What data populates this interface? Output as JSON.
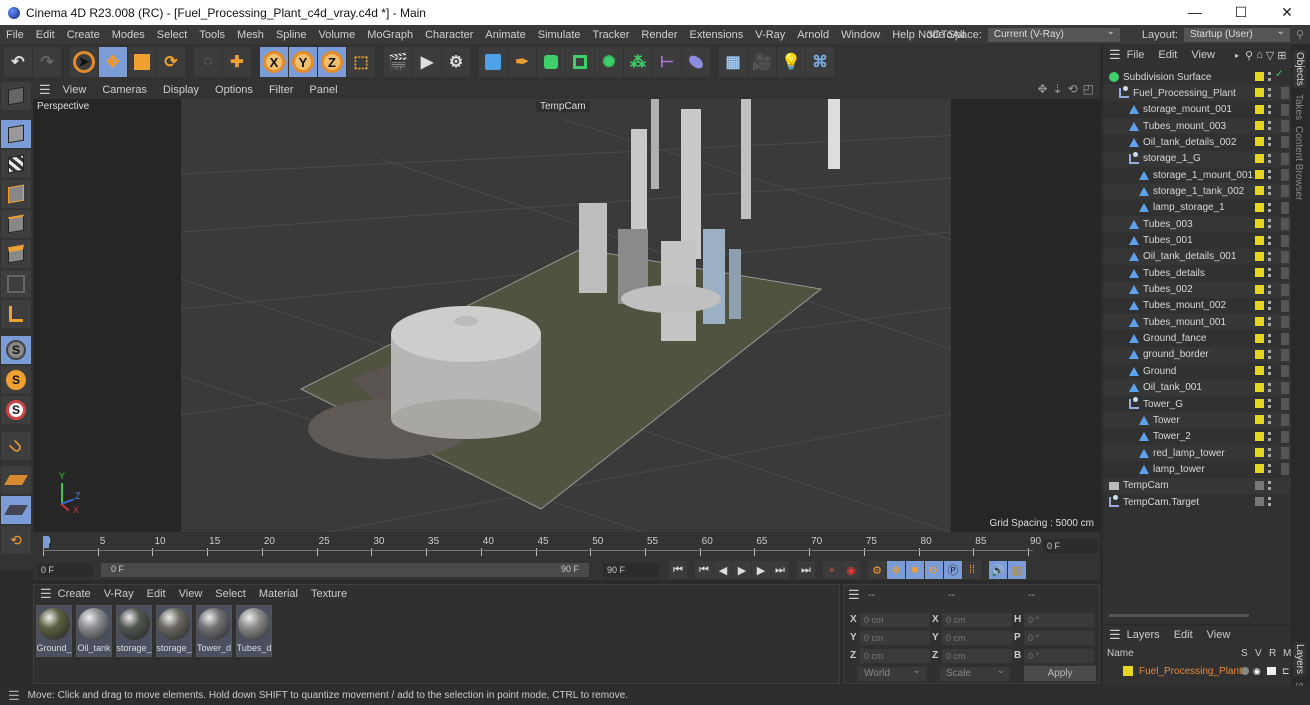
{
  "window": {
    "title": "Cinema 4D R23.008 (RC) - [Fuel_Processing_Plant_c4d_vray.c4d *] - Main",
    "minimize": "—",
    "maximize": "☐",
    "close": "✕"
  },
  "menubar": {
    "items": [
      "File",
      "Edit",
      "Create",
      "Modes",
      "Select",
      "Tools",
      "Mesh",
      "Spline",
      "Volume",
      "MoGraph",
      "Character",
      "Animate",
      "Simulate",
      "Tracker",
      "Render",
      "Extensions",
      "V-Ray",
      "Arnold",
      "Window",
      "Help",
      "3DToAll"
    ],
    "node_space_label": "Node Space:",
    "node_space_value": "Current (V-Ray)",
    "layout_label": "Layout:",
    "layout_value": "Startup (User)"
  },
  "toolbar": {
    "axis_x": "X",
    "axis_y": "Y",
    "axis_z": "Z"
  },
  "viewport": {
    "menu": [
      "View",
      "Cameras",
      "Display",
      "Options",
      "Filter",
      "Panel"
    ],
    "view_name": "Perspective",
    "camera_label": "TempCam",
    "grid_spacing": "Grid Spacing : 5000 cm",
    "axis_labels": {
      "y": "Y",
      "z": "Z",
      "x": "X"
    }
  },
  "timeline": {
    "ticks": [
      "0",
      "5",
      "10",
      "15",
      "20",
      "25",
      "30",
      "35",
      "40",
      "45",
      "50",
      "55",
      "60",
      "65",
      "70",
      "75",
      "80",
      "85",
      "90"
    ],
    "current_frame_field": "0 F",
    "start_field": "0 F",
    "range_start": "0 F",
    "range_end": "90 F",
    "end_field": "90 F"
  },
  "materials": {
    "menu": [
      "Create",
      "V-Ray",
      "Edit",
      "View",
      "Select",
      "Material",
      "Texture"
    ],
    "items": [
      {
        "label": "Ground_",
        "color": "#5a6040"
      },
      {
        "label": "Oil_tank",
        "color": "#8a8c90"
      },
      {
        "label": "storage_",
        "color": "#505650"
      },
      {
        "label": "storage_",
        "color": "#6a6860"
      },
      {
        "label": "Tower_d",
        "color": "#707274"
      },
      {
        "label": "Tubes_d",
        "color": "#8a8a8a"
      }
    ]
  },
  "coordinates": {
    "headers": [
      "--",
      "--",
      "--"
    ],
    "rows": [
      {
        "l1": "X",
        "v1": "0 cm",
        "l2": "X",
        "v2": "0 cm",
        "l3": "H",
        "v3": "0 °"
      },
      {
        "l1": "Y",
        "v1": "0 cm",
        "l2": "Y",
        "v2": "0 cm",
        "l3": "P",
        "v3": "0 °"
      },
      {
        "l1": "Z",
        "v1": "0 cm",
        "l2": "Z",
        "v2": "0 cm",
        "l3": "B",
        "v3": "0 °"
      }
    ],
    "mode": "World",
    "scale": "Scale",
    "apply": "Apply"
  },
  "objects": {
    "menu": [
      "File",
      "Edit",
      "View"
    ],
    "items": [
      {
        "name": "Subdivision Surface",
        "depth": 0,
        "icon": "subdivision",
        "swatch": "yellow",
        "check": true
      },
      {
        "name": "Fuel_Processing_Plant",
        "depth": 1,
        "icon": "null",
        "swatch": "yellow"
      },
      {
        "name": "storage_mount_001",
        "depth": 2,
        "icon": "poly",
        "swatch": "yellow"
      },
      {
        "name": "Tubes_mount_003",
        "depth": 2,
        "icon": "poly",
        "swatch": "yellow"
      },
      {
        "name": "Oil_tank_details_002",
        "depth": 2,
        "icon": "poly",
        "swatch": "yellow"
      },
      {
        "name": "storage_1_G",
        "depth": 2,
        "icon": "null",
        "swatch": "yellow"
      },
      {
        "name": "storage_1_mount_001",
        "depth": 3,
        "icon": "poly",
        "swatch": "yellow"
      },
      {
        "name": "storage_1_tank_002",
        "depth": 3,
        "icon": "poly",
        "swatch": "yellow"
      },
      {
        "name": "lamp_storage_1",
        "depth": 3,
        "icon": "poly",
        "swatch": "yellow"
      },
      {
        "name": "Tubes_003",
        "depth": 2,
        "icon": "poly",
        "swatch": "yellow"
      },
      {
        "name": "Tubes_001",
        "depth": 2,
        "icon": "poly",
        "swatch": "yellow"
      },
      {
        "name": "Oil_tank_details_001",
        "depth": 2,
        "icon": "poly",
        "swatch": "yellow"
      },
      {
        "name": "Tubes_details",
        "depth": 2,
        "icon": "poly",
        "swatch": "yellow"
      },
      {
        "name": "Tubes_002",
        "depth": 2,
        "icon": "poly",
        "swatch": "yellow"
      },
      {
        "name": "Tubes_mount_002",
        "depth": 2,
        "icon": "poly",
        "swatch": "yellow"
      },
      {
        "name": "Tubes_mount_001",
        "depth": 2,
        "icon": "poly",
        "swatch": "yellow"
      },
      {
        "name": "Ground_fance",
        "depth": 2,
        "icon": "poly",
        "swatch": "yellow"
      },
      {
        "name": "ground_border",
        "depth": 2,
        "icon": "poly",
        "swatch": "yellow"
      },
      {
        "name": "Ground",
        "depth": 2,
        "icon": "poly",
        "swatch": "yellow"
      },
      {
        "name": "Oil_tank_001",
        "depth": 2,
        "icon": "poly",
        "swatch": "yellow"
      },
      {
        "name": "Tower_G",
        "depth": 2,
        "icon": "null",
        "swatch": "yellow"
      },
      {
        "name": "Tower",
        "depth": 3,
        "icon": "poly",
        "swatch": "yellow"
      },
      {
        "name": "Tower_2",
        "depth": 3,
        "icon": "poly",
        "swatch": "yellow"
      },
      {
        "name": "red_lamp_tower",
        "depth": 3,
        "icon": "poly",
        "swatch": "yellow"
      },
      {
        "name": "lamp_tower",
        "depth": 3,
        "icon": "poly",
        "swatch": "yellow"
      },
      {
        "name": "TempCam",
        "depth": 0,
        "icon": "camera",
        "swatch": "gray"
      },
      {
        "name": "TempCam.Target",
        "depth": 0,
        "icon": "null",
        "swatch": "gray"
      }
    ]
  },
  "side_tabs": [
    "Objects",
    "Takes",
    "Content Browser"
  ],
  "side_tabs_bottom": [
    "Layers",
    "Str"
  ],
  "layers": {
    "menu": [
      "Layers",
      "Edit",
      "View"
    ],
    "columns": {
      "name": "Name",
      "s": "S",
      "v": "V",
      "r": "R",
      "m": "M"
    },
    "items": [
      {
        "name": "Fuel_Processing_Plant",
        "color": "#e6d621"
      }
    ]
  },
  "status": "Move: Click and drag to move elements. Hold down SHIFT to quantize movement / add to the selection in point mode, CTRL to remove."
}
